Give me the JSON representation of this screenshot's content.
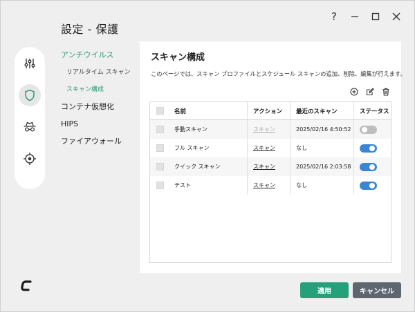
{
  "window": {
    "title": "設定 - 保護"
  },
  "window_controls": {
    "help": "?",
    "minimize": "—",
    "maximize": "☐",
    "close": "✕"
  },
  "icon_rail": [
    "tuning-sliders-icon",
    "shield-icon",
    "spy-hat-icon",
    "crosshair-virus-icon"
  ],
  "nav": {
    "antivirus": "アンチウイルス",
    "realtime_scan": "リアルタイム スキャン",
    "scan_config": "スキャン構成",
    "container": "コンテナ仮想化",
    "hips": "HIPS",
    "firewall": "ファイアウォール"
  },
  "panel": {
    "title": "スキャン構成",
    "description": "このページでは、スキャン プロファイルとスケジュール スキャンの追加、削除、編集が行えます。"
  },
  "table": {
    "columns": {
      "name": "名前",
      "action": "アクション",
      "last_scan": "最近のスキャン",
      "status": "ステータス"
    },
    "rows": [
      {
        "name": "手動スキャン",
        "action": "スキャン",
        "last_scan": "2025/02/16 4:50:52",
        "status": "off"
      },
      {
        "name": "フル スキャン",
        "action": "スキャン",
        "last_scan": "なし",
        "status": "on"
      },
      {
        "name": "クイック スキャン",
        "action": "スキャン",
        "last_scan": "2025/02/16 2:03:58",
        "status": "on"
      },
      {
        "name": "テスト",
        "action": "スキャン",
        "last_scan": "なし",
        "status": "on"
      }
    ]
  },
  "buttons": {
    "apply": "適用",
    "cancel": "キャンセル"
  },
  "colors": {
    "accent_green": "#26a079",
    "toggle_on": "#3a86d6",
    "cancel_gray": "#5e6670"
  }
}
